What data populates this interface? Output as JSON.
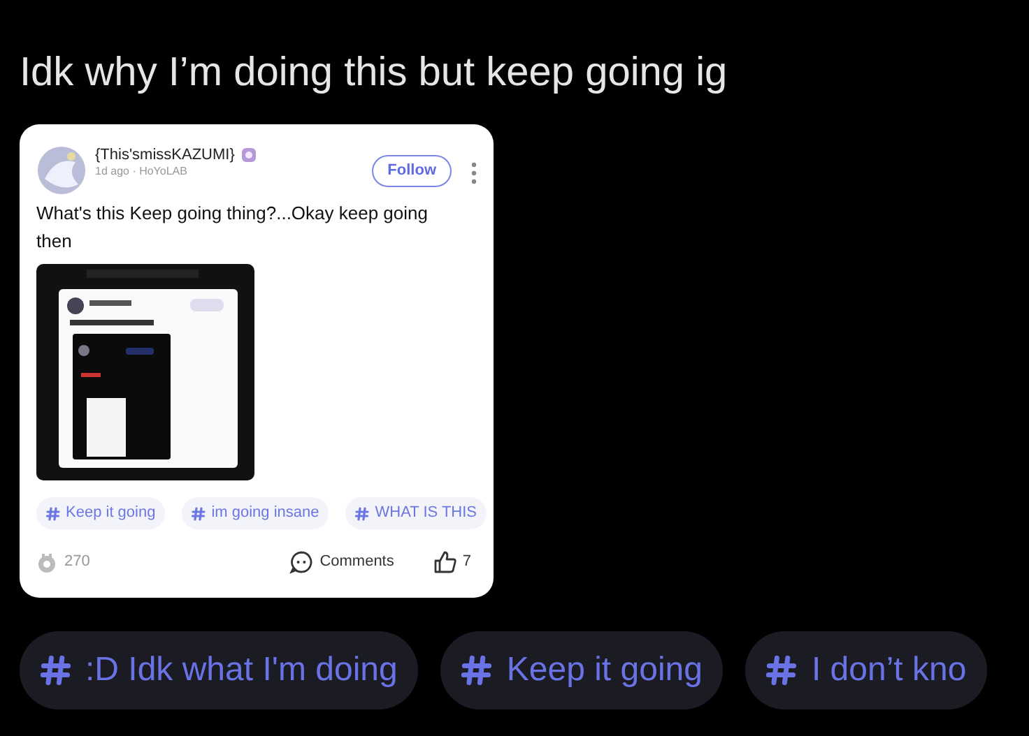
{
  "title": "Idk why I’m doing this but keep going ig",
  "post": {
    "author": "{This'smissKAZUMI}",
    "meta": "1d ago · HoYoLAB",
    "follow": "Follow",
    "text": "What's this Keep going thing?...Okay keep going then",
    "tags": [
      "Keep it going",
      "im going insane",
      "WHAT IS THIS"
    ],
    "views": "270",
    "comments": "Comments",
    "likes": "7"
  },
  "topics": [
    ":D Idk what I'm doing",
    "Keep it going",
    "I don’t kno"
  ]
}
